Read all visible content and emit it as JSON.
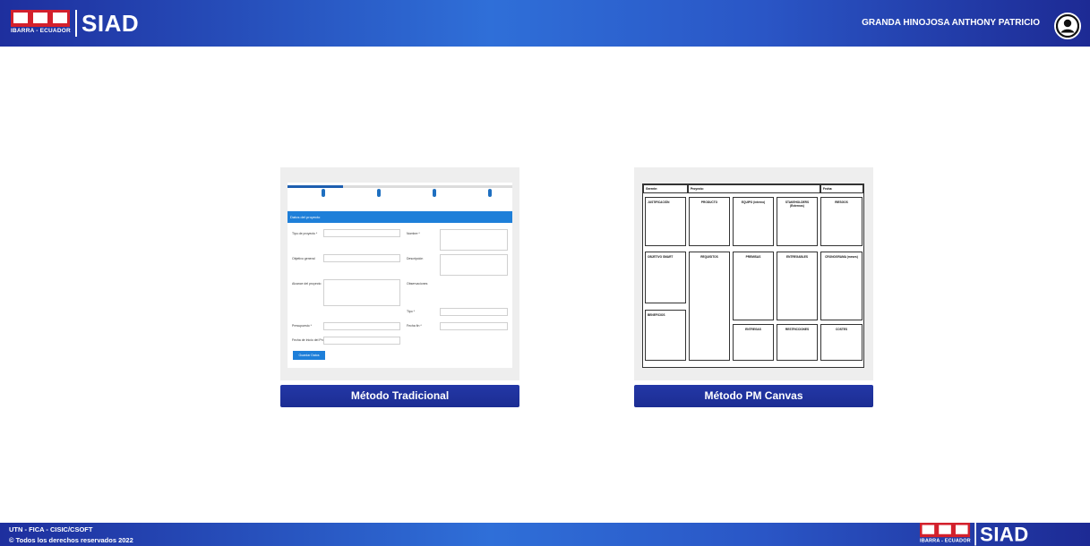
{
  "header": {
    "logo_subtext": "IBARRA - ECUADOR",
    "logo_word": "SIAD",
    "user_name": "GRANDA HINOJOSA ANTHONY PATRICIO"
  },
  "cards": [
    {
      "button_label": "Método Tradicional",
      "thumb": {
        "header": "Datos del proyecto",
        "labels": [
          "Tipo de proyecto *",
          "Objetivo general",
          "Alcance del proyecto",
          "Presupuesto *",
          "Fecha de Inicio del Proyecto",
          "Nombre *",
          "Descripción",
          "Observaciones",
          "Tipo *",
          "Fecha fin *"
        ],
        "save": "Guardar Datos"
      }
    },
    {
      "button_label": "Método PM Canvas",
      "thumb": {
        "top": [
          "Gerente:",
          "Proyecto:",
          "Fecha:"
        ],
        "cells": [
          "JUSTIFICACIÓN",
          "PRODUCTO",
          "EQUIPO (interno)",
          "STAKEHOLDERS (Externos)",
          "RIESGOS",
          "OBJETIVO SMART",
          "REQUISITOS",
          "PREMISAS",
          "ENTREGABLES",
          "CRONOGRAMA (meses)",
          "BENEFICIOS",
          "RESTRICCIONES",
          "COSTES",
          "ENTREGAS"
        ]
      }
    }
  ],
  "footer": {
    "line1": "UTN - FICA - CISIC/CSOFT",
    "line2": "© Todos los derechos reservados 2022",
    "logo_subtext": "IBARRA - ECUADOR",
    "logo_word": "SIAD"
  }
}
